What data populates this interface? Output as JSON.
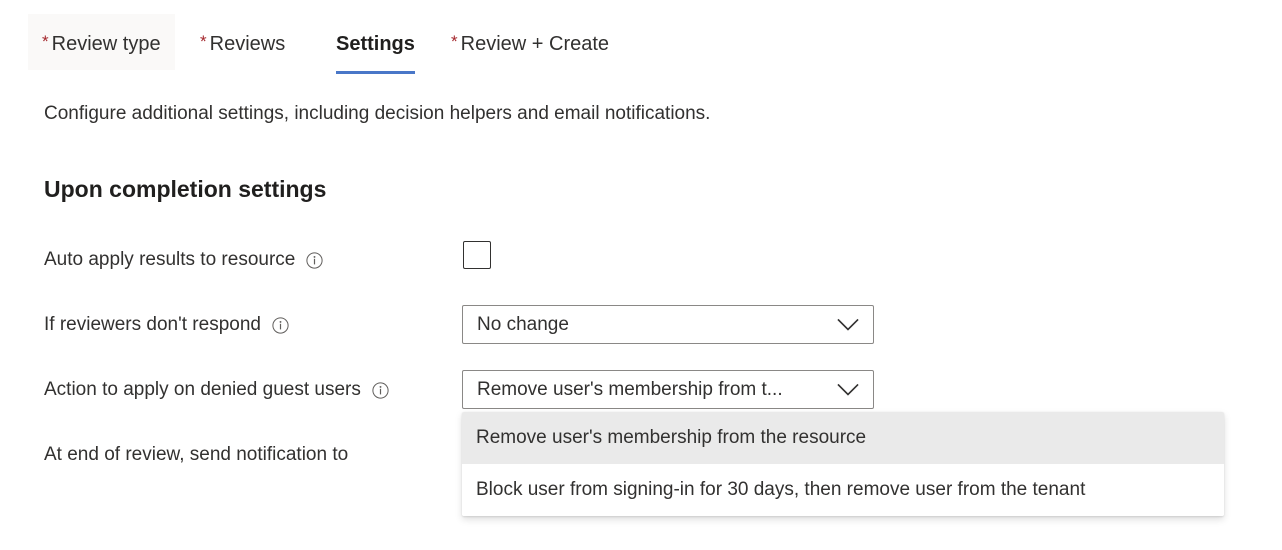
{
  "tabs": [
    {
      "label": "Review type",
      "required": true,
      "active": false,
      "hovered": true
    },
    {
      "label": "Reviews",
      "required": true,
      "active": false,
      "hovered": false
    },
    {
      "label": "Settings",
      "required": false,
      "active": true,
      "hovered": false
    },
    {
      "label": "Review + Create",
      "required": true,
      "active": false,
      "hovered": false
    }
  ],
  "required_marker": "*",
  "intro": "Configure additional settings, including decision helpers and email notifications.",
  "section": {
    "title": "Upon completion settings"
  },
  "fields": {
    "auto_apply": {
      "label": "Auto apply results to resource",
      "info_icon": "info-circle-icon",
      "checkbox_checked": false
    },
    "no_respond": {
      "label": "If reviewers don't respond",
      "info_icon": "info-circle-icon",
      "value": "No change",
      "chevron_icon": "chevron-down-icon"
    },
    "denied_guest": {
      "label": "Action to apply on denied guest users",
      "info_icon": "info-circle-icon",
      "value": "Remove user's membership from t...",
      "chevron_icon": "chevron-down-icon"
    },
    "notify": {
      "label": "At end of review, send notification to"
    }
  },
  "dropdown": {
    "open": true,
    "options": [
      {
        "label": "Remove user's membership from the resource",
        "selected": true
      },
      {
        "label": "Block user from signing-in for 30 days, then remove user from the tenant",
        "selected": false
      }
    ]
  },
  "colors": {
    "accent_underline": "#4977c8",
    "required_asterisk": "#a4262c",
    "text": "#323130",
    "option_selected_bg": "#eaeaea",
    "tab_hover_bg": "#faf9f8"
  }
}
